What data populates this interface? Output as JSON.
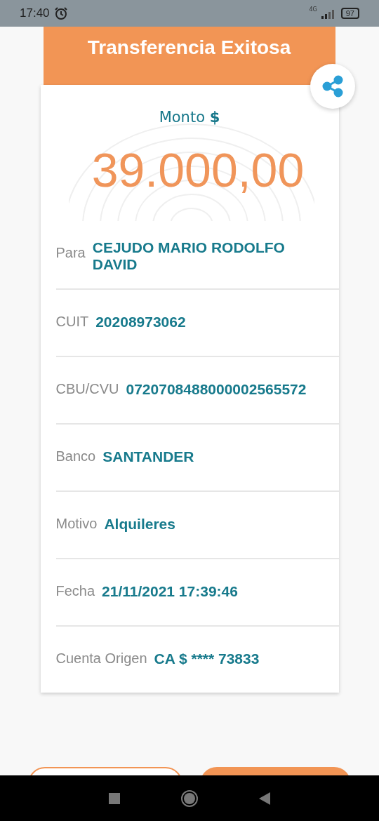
{
  "status_bar": {
    "time": "17:40",
    "network": "4G",
    "battery": "97"
  },
  "header": {
    "title": "Transferencia Exitosa"
  },
  "amount": {
    "label": "Monto **$**",
    "value": "39.000,00"
  },
  "details": [
    {
      "label": "Para",
      "value": "CEJUDO MARIO RODOLFO DAVID"
    },
    {
      "label": "CUIT",
      "value": "20208973062"
    },
    {
      "label": "CBU/CVU",
      "value": "0720708488000002565572"
    },
    {
      "label": "Banco",
      "value": "SANTANDER"
    },
    {
      "label": "Motivo",
      "value": "Alquileres"
    },
    {
      "label": "Fecha",
      "value": "21/11/2021 17:39:46"
    },
    {
      "label": "Cuenta Origen",
      "value": "CA $ **** 73833"
    }
  ],
  "buttons": [
    {
      "kind": "outline"
    },
    {
      "kind": "filled"
    }
  ]
}
